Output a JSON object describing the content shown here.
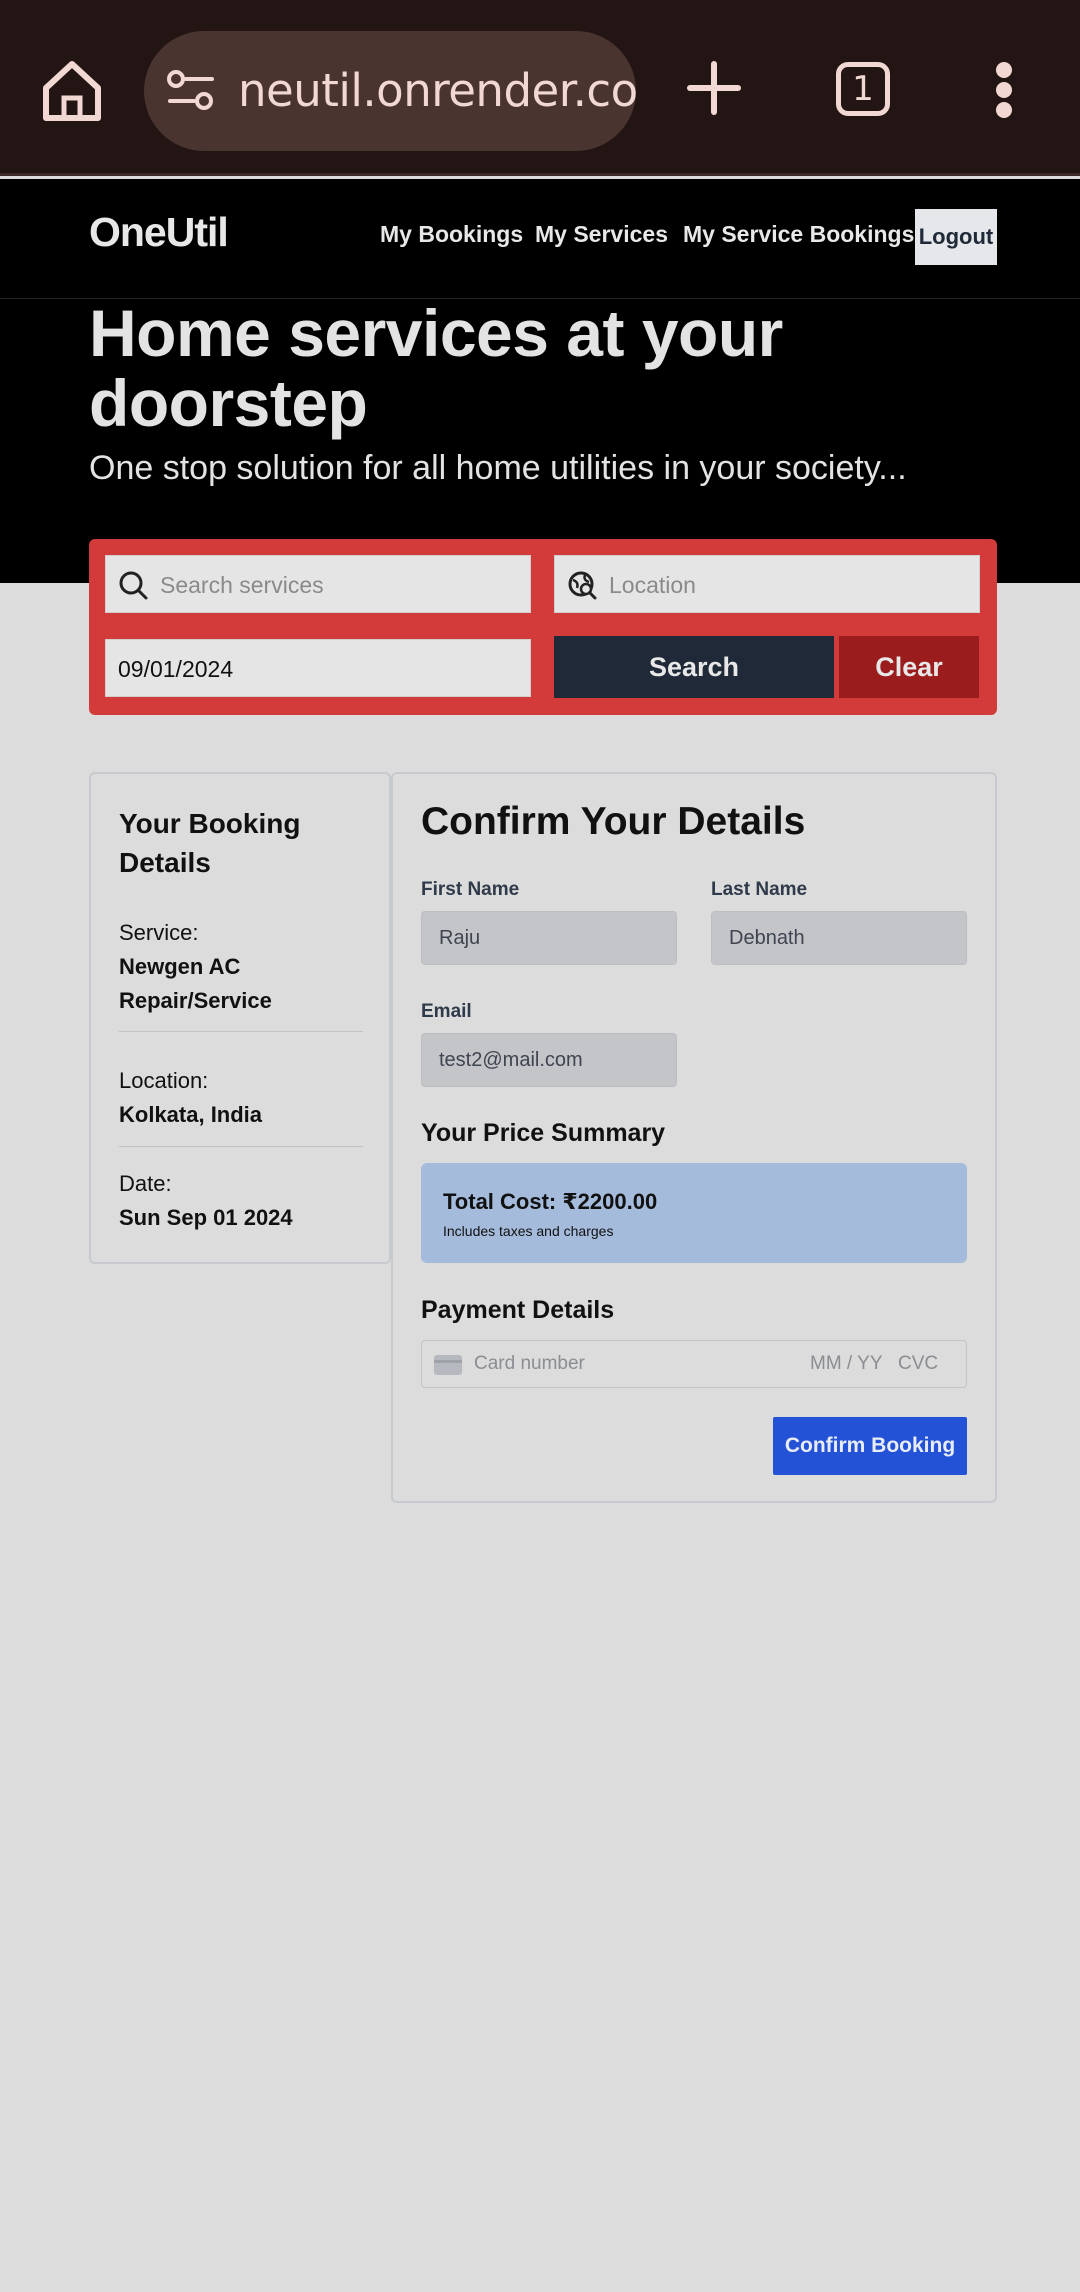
{
  "browser": {
    "url": "neutil.onrender.com",
    "tab_count": "1",
    "icons": [
      "home-icon",
      "site-settings-icon",
      "new-tab-icon",
      "tab-switcher-icon",
      "more-vert-icon"
    ]
  },
  "nav": {
    "logo": "OneUtil",
    "links": [
      "My Bookings",
      "My Services",
      "My Service Bookings"
    ],
    "logout": "Logout"
  },
  "hero": {
    "title": "Home services at your doorstep",
    "subtitle": "One stop solution for all home utilities in your society..."
  },
  "search": {
    "service_placeholder": "Search services",
    "location_placeholder": "Location",
    "date_value": "09/01/2024",
    "search_label": "Search",
    "clear_label": "Clear"
  },
  "booking": {
    "title": "Your Booking Details",
    "service_label": "Service:",
    "service_value": "Newgen AC Repair/Service",
    "location_label": "Location:",
    "location_value": "Kolkata, India",
    "date_label": "Date:",
    "date_value": "Sun Sep 01 2024"
  },
  "confirm": {
    "title": "Confirm Your Details",
    "first_name_label": "First Name",
    "first_name_value": "Raju",
    "last_name_label": "Last Name",
    "last_name_value": "Debnath",
    "email_label": "Email",
    "email_value": "test2@mail.com",
    "price_heading": "Your Price Summary",
    "total": "Total Cost: ₹2200.00",
    "total_note": "Includes taxes and charges",
    "payment_heading": "Payment Details",
    "card_placeholder": "Card number",
    "expiry_placeholder": "MM / YY",
    "cvc_placeholder": "CVC",
    "confirm_label": "Confirm Booking"
  },
  "colors": {
    "search_panel": "#d33a3a",
    "search_button": "#1f2937",
    "clear_button": "#9b1c1c",
    "confirm_button": "#2452d6",
    "price_box": "#a4bbdc"
  }
}
